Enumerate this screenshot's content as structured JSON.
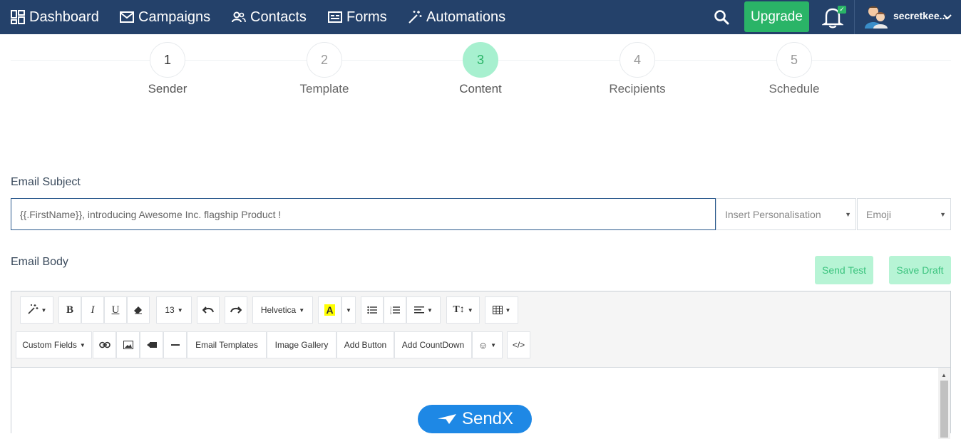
{
  "nav": {
    "dashboard": "Dashboard",
    "campaigns": "Campaigns",
    "contacts": "Contacts",
    "forms": "Forms",
    "automations": "Automations",
    "upgrade": "Upgrade",
    "username": "secretkee...",
    "icons": [
      "dashboard-icon",
      "envelope-icon",
      "users-icon",
      "form-icon",
      "magic-wand-icon",
      "search-icon",
      "bell-icon",
      "avatar-icon",
      "chevron-down-icon"
    ]
  },
  "stepper": {
    "steps": [
      {
        "number": "1",
        "label": "Sender"
      },
      {
        "number": "2",
        "label": "Template"
      },
      {
        "number": "3",
        "label": "Content"
      },
      {
        "number": "4",
        "label": "Recipients"
      },
      {
        "number": "5",
        "label": "Schedule"
      }
    ],
    "active_step": 3
  },
  "subject": {
    "label": "Email Subject",
    "placeholder": "{{.FirstName}}, introducing Awesome Inc. flagship Product !",
    "personalisation": "Insert Personalisation",
    "emoji": "Emoji"
  },
  "body": {
    "label": "Email Body",
    "send_test": "Send Test",
    "save_draft": "Save Draft"
  },
  "toolbar": {
    "font_size": "13",
    "font_name": "Helvetica",
    "custom_fields": "Custom Fields",
    "email_templates": "Email Templates",
    "image_gallery": "Image Gallery",
    "add_button": "Add Button",
    "add_countdown": "Add CountDown",
    "code_view": "</>"
  },
  "preview": {
    "logo_text": "SendX"
  },
  "colors": {
    "navbar": "#24416a",
    "upgrade": "#2ab467",
    "active_step": "#a7f0cf",
    "light_button": "#b7f4d5",
    "logo": "#1e88e5"
  }
}
